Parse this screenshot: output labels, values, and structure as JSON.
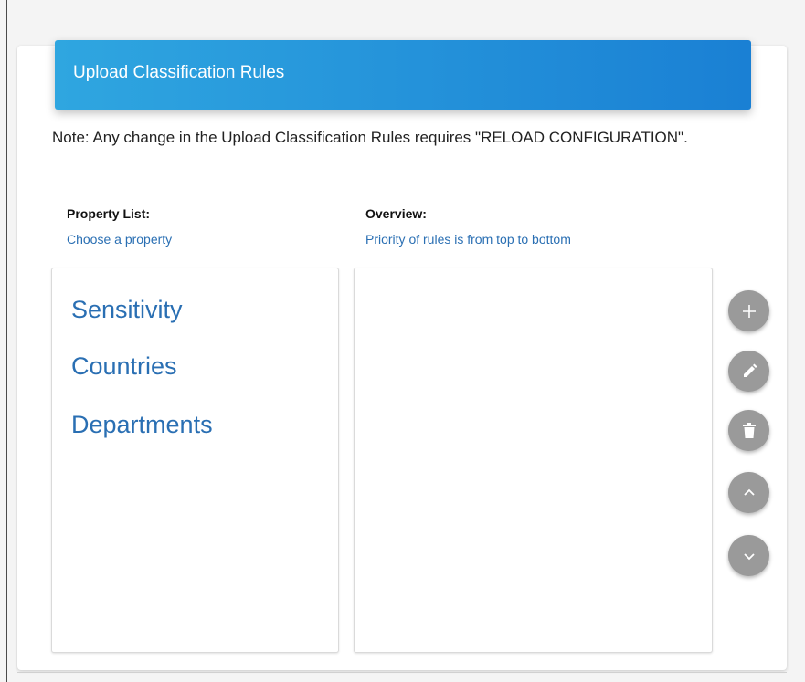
{
  "header": {
    "title": "Upload Classification Rules"
  },
  "note": {
    "text": "Note: Any change in the Upload Classification Rules requires \"RELOAD CONFIGURATION\"."
  },
  "property_list": {
    "title": "Property List:",
    "subtitle": "Choose a property",
    "items": [
      "Sensitivity",
      "Countries",
      "Departments"
    ]
  },
  "overview": {
    "title": "Overview:",
    "subtitle": "Priority of rules is from top to bottom"
  },
  "actions": [
    {
      "name": "add",
      "icon": "plus-icon"
    },
    {
      "name": "edit",
      "icon": "pencil-icon"
    },
    {
      "name": "delete",
      "icon": "trash-icon"
    },
    {
      "name": "move-up",
      "icon": "chevron-up-icon"
    },
    {
      "name": "move-down",
      "icon": "chevron-down-icon"
    }
  ],
  "colors": {
    "header_start": "#2fa6e0",
    "header_end": "#1a80d4",
    "link": "#2a6fb3",
    "fab": "#9a9a9a"
  }
}
